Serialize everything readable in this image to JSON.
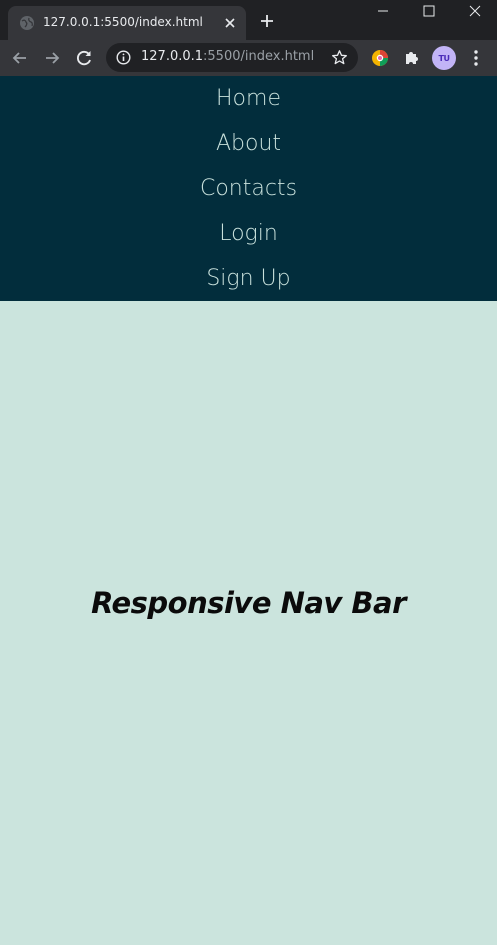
{
  "browser": {
    "tab_title": "127.0.0.1:5500/index.html",
    "url_host": "127.0.0.1",
    "url_path": ":5500/index.html",
    "avatar_text": "TU"
  },
  "icons": {
    "tab_favicon": "globe-icon",
    "tab_close": "close-icon",
    "new_tab": "plus-icon",
    "back": "arrow-left-icon",
    "forward": "arrow-right-icon",
    "reload": "reload-icon",
    "site_info": "info-icon",
    "bookmark": "star-icon",
    "extension": "colorful-extension-icon",
    "extensions_menu": "puzzle-icon",
    "browser_menu": "kebab-menu-icon"
  },
  "navbar": {
    "links": [
      "Home",
      "About",
      "Contacts",
      "Login",
      "Sign Up"
    ]
  },
  "main": {
    "title": "Responsive Nav Bar"
  },
  "colors": {
    "navbar_bg": "#022d3c",
    "nav_text": "#c9e1dc",
    "page_bg": "#cbe4dd",
    "title_text": "#0b0b0b"
  }
}
